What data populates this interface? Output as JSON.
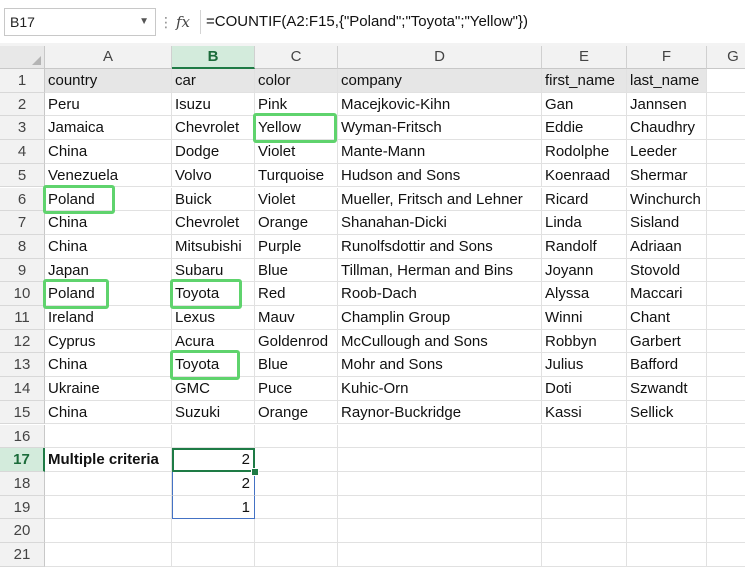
{
  "formula_bar": {
    "name_box": "B17",
    "fx_label": "fx",
    "formula": "=COUNTIF(A2:F15,{\"Poland\";\"Toyota\";\"Yellow\"})"
  },
  "columns": [
    "A",
    "B",
    "C",
    "D",
    "E",
    "F",
    "G"
  ],
  "active_column": "B",
  "active_row": 17,
  "rows": [
    {
      "n": "1",
      "cells": [
        "country",
        "car",
        "color",
        "company",
        "first_name",
        "last_name"
      ]
    },
    {
      "n": "2",
      "cells": [
        "Peru",
        "Isuzu",
        "Pink",
        "Macejkovic-Kihn",
        "Gan",
        "Jannsen"
      ]
    },
    {
      "n": "3",
      "cells": [
        "Jamaica",
        "Chevrolet",
        "Yellow",
        "Wyman-Fritsch",
        "Eddie",
        "Chaudhry"
      ]
    },
    {
      "n": "4",
      "cells": [
        "China",
        "Dodge",
        "Violet",
        "Mante-Mann",
        "Rodolphe",
        "Leeder"
      ]
    },
    {
      "n": "5",
      "cells": [
        "Venezuela",
        "Volvo",
        "Turquoise",
        "Hudson and Sons",
        "Koenraad",
        "Shermar"
      ]
    },
    {
      "n": "6",
      "cells": [
        "Poland",
        "Buick",
        "Violet",
        "Mueller, Fritsch and Lehner",
        "Ricard",
        "Winchurch"
      ]
    },
    {
      "n": "7",
      "cells": [
        "China",
        "Chevrolet",
        "Orange",
        "Shanahan-Dicki",
        "Linda",
        "Sisland"
      ]
    },
    {
      "n": "8",
      "cells": [
        "China",
        "Mitsubishi",
        "Purple",
        "Runolfsdottir and Sons",
        "Randolf",
        "Adriaan"
      ]
    },
    {
      "n": "9",
      "cells": [
        "Japan",
        "Subaru",
        "Blue",
        "Tillman, Herman and Bins",
        "Joyann",
        "Stovold"
      ]
    },
    {
      "n": "10",
      "cells": [
        "Poland",
        "Toyota",
        "Red",
        "Roob-Dach",
        "Alyssa",
        "Maccari"
      ]
    },
    {
      "n": "11",
      "cells": [
        "Ireland",
        "Lexus",
        "Mauv",
        "Champlin Group",
        "Winni",
        "Chant"
      ]
    },
    {
      "n": "12",
      "cells": [
        "Cyprus",
        "Acura",
        "Goldenrod",
        "McCullough and Sons",
        "Robbyn",
        "Garbert"
      ]
    },
    {
      "n": "13",
      "cells": [
        "China",
        "Toyota",
        "Blue",
        "Mohr and Sons",
        "Julius",
        "Bafford"
      ]
    },
    {
      "n": "14",
      "cells": [
        "Ukraine",
        "GMC",
        "Puce",
        "Kuhic-Orn",
        "Doti",
        "Szwandt"
      ]
    },
    {
      "n": "15",
      "cells": [
        "China",
        "Suzuki",
        "Orange",
        "Raynor-Buckridge",
        "Kassi",
        "Sellick"
      ]
    },
    {
      "n": "16",
      "cells": [
        "",
        "",
        "",
        "",
        "",
        ""
      ]
    },
    {
      "n": "17",
      "cells": [
        "Multiple criteria",
        "2",
        "",
        "",
        "",
        ""
      ]
    },
    {
      "n": "18",
      "cells": [
        "",
        "2",
        "",
        "",
        "",
        ""
      ]
    },
    {
      "n": "19",
      "cells": [
        "",
        "1",
        "",
        "",
        "",
        ""
      ]
    },
    {
      "n": "20",
      "cells": [
        "",
        "",
        "",
        "",
        "",
        ""
      ]
    },
    {
      "n": "21",
      "cells": [
        "",
        "",
        "",
        "",
        "",
        ""
      ]
    }
  ],
  "highlighted_cells": [
    "C3",
    "A6",
    "A10",
    "B10",
    "B13"
  ],
  "colors": {
    "active_green": "#1e7b45",
    "highlight_green": "#5fd36d",
    "header_fill": "#e6e6e6",
    "spill_blue": "#4472c4"
  }
}
